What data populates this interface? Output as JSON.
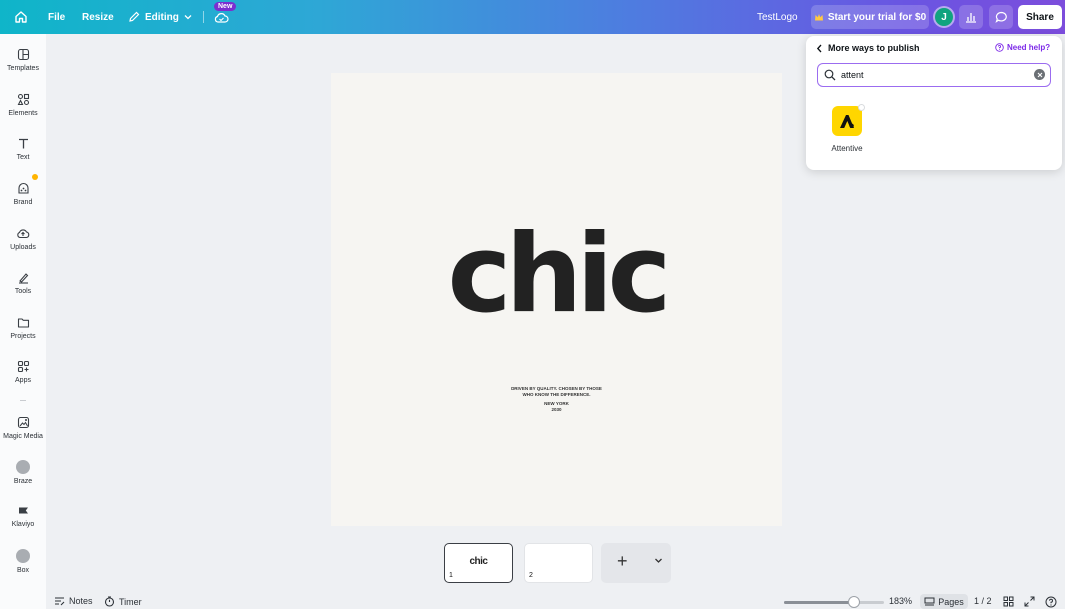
{
  "topbar": {
    "file_label": "File",
    "resize_label": "Resize",
    "editing_label": "Editing",
    "new_badge": "New",
    "doc_title": "TestLogo",
    "trial_label": "Start your trial for $0",
    "avatar_initial": "J",
    "share_label": "Share",
    "gradient_colors": [
      "#0fb5c9",
      "#4f7be0",
      "#7c4ddc"
    ]
  },
  "sidebar": {
    "items": [
      {
        "label": "Templates",
        "icon": "templates-icon"
      },
      {
        "label": "Elements",
        "icon": "elements-icon"
      },
      {
        "label": "Text",
        "icon": "text-icon"
      },
      {
        "label": "Brand",
        "icon": "brand-icon"
      },
      {
        "label": "Uploads",
        "icon": "uploads-icon"
      },
      {
        "label": "Tools",
        "icon": "tools-icon"
      },
      {
        "label": "Projects",
        "icon": "projects-icon"
      },
      {
        "label": "Apps",
        "icon": "apps-icon"
      },
      {
        "label": "Magic Media",
        "icon": "magic-media-icon"
      },
      {
        "label": "Braze",
        "icon": "braze-icon"
      },
      {
        "label": "Klaviyo",
        "icon": "klaviyo-icon"
      },
      {
        "label": "Box",
        "icon": "box-icon"
      }
    ]
  },
  "canvas": {
    "main_word": "chic",
    "tagline_line1": "DRIVEN BY QUALITY. CHOSEN BY THOSE",
    "tagline_line2": "WHO KNOW THE DIFFERENCE.",
    "city": "NEW YORK",
    "year": "2030"
  },
  "pages": {
    "thumbs": [
      {
        "number": "1",
        "preview": "chic"
      },
      {
        "number": "2"
      }
    ],
    "add_label": "+"
  },
  "bottombar": {
    "notes_label": "Notes",
    "timer_label": "Timer",
    "zoom": "183%",
    "zoom_fraction": 0.7,
    "pages_label": "Pages",
    "page_count": "1 / 2"
  },
  "publish_panel": {
    "back_label": "More ways to publish",
    "help_label": "Need help?",
    "search_value": "attent",
    "results": [
      {
        "name": "Attentive",
        "logo_color": "#ffd600"
      }
    ]
  }
}
